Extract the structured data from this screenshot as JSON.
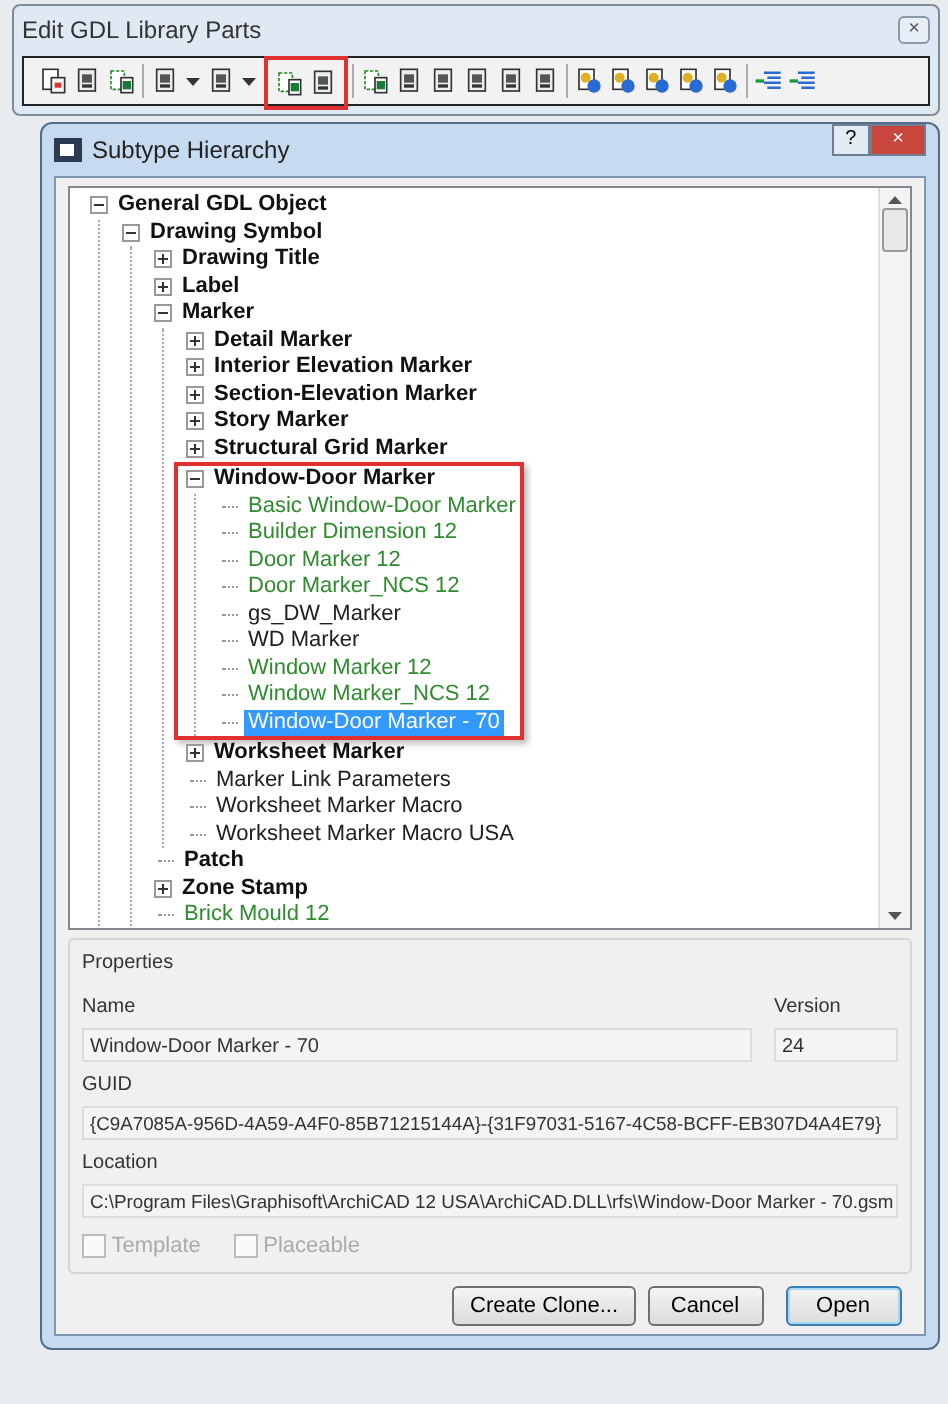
{
  "toolbar_window": {
    "title": "Edit GDL Library Parts",
    "close": "×",
    "groups": [
      {
        "buttons": [
          {
            "kind": "plain"
          },
          {
            "kind": "plain"
          },
          {
            "kind": "plain"
          }
        ]
      },
      {
        "buttons": [
          {
            "kind": "split"
          },
          {
            "kind": "split"
          }
        ],
        "highlighted_after": {
          "buttons": [
            {
              "kind": "plain"
            },
            {
              "kind": "plain"
            }
          ]
        }
      },
      {
        "buttons": [
          {
            "kind": "plain"
          },
          {
            "kind": "plain"
          },
          {
            "kind": "plain"
          },
          {
            "kind": "plain"
          },
          {
            "kind": "plain"
          },
          {
            "kind": "plain"
          }
        ]
      },
      {
        "buttons": [
          {
            "kind": "plain"
          },
          {
            "kind": "plain"
          },
          {
            "kind": "plain"
          },
          {
            "kind": "plain"
          },
          {
            "kind": "plain"
          }
        ]
      },
      {
        "buttons": [
          {
            "kind": "plain"
          },
          {
            "kind": "plain"
          }
        ]
      }
    ]
  },
  "dialog": {
    "title": "Subtype Hierarchy",
    "help": "?",
    "close": "×",
    "tree": [
      {
        "label": "General GDL Object",
        "kind": "category",
        "expanded": true,
        "children": [
          {
            "label": "Drawing Symbol",
            "kind": "category",
            "expanded": true,
            "children": [
              {
                "label": "Drawing Title",
                "kind": "category",
                "expanded": false
              },
              {
                "label": "Label",
                "kind": "category",
                "expanded": false
              },
              {
                "label": "Marker",
                "kind": "category",
                "expanded": true,
                "children": [
                  {
                    "label": "Detail Marker",
                    "kind": "category",
                    "expanded": false
                  },
                  {
                    "label": "Interior Elevation Marker",
                    "kind": "category",
                    "expanded": false
                  },
                  {
                    "label": "Section-Elevation Marker",
                    "kind": "category",
                    "expanded": false
                  },
                  {
                    "label": "Story Marker",
                    "kind": "category",
                    "expanded": false
                  },
                  {
                    "label": "Structural Grid Marker",
                    "kind": "category",
                    "expanded": false
                  },
                  {
                    "label": "Window-Door Marker",
                    "kind": "category",
                    "expanded": true,
                    "highlighted": true,
                    "children": [
                      {
                        "label": "Basic Window-Door Marker",
                        "kind": "part",
                        "color": "#2e8b2e",
                        "selected": false
                      },
                      {
                        "label": "Builder Dimension 12",
                        "kind": "part",
                        "color": "#2e8b2e",
                        "selected": false
                      },
                      {
                        "label": "Door Marker 12",
                        "kind": "part",
                        "color": "#2e8b2e",
                        "selected": false
                      },
                      {
                        "label": "Door Marker_NCS 12",
                        "kind": "part",
                        "color": "#2e8b2e",
                        "selected": false
                      },
                      {
                        "label": "gs_DW_Marker",
                        "kind": "part",
                        "color": "#202020",
                        "selected": false
                      },
                      {
                        "label": "WD Marker",
                        "kind": "part",
                        "color": "#202020",
                        "selected": false
                      },
                      {
                        "label": "Window Marker 12",
                        "kind": "part",
                        "color": "#2e8b2e",
                        "selected": false
                      },
                      {
                        "label": "Window Marker_NCS 12",
                        "kind": "part",
                        "color": "#2e8b2e",
                        "selected": false
                      },
                      {
                        "label": "Window-Door Marker - 70",
                        "kind": "part",
                        "selected": true
                      }
                    ]
                  },
                  {
                    "label": "Worksheet Marker",
                    "kind": "category",
                    "expanded": false
                  },
                  {
                    "label": "Marker Link Parameters",
                    "kind": "part",
                    "color": "#202020",
                    "selected": false
                  },
                  {
                    "label": "Worksheet Marker Macro",
                    "kind": "part",
                    "color": "#202020",
                    "selected": false
                  },
                  {
                    "label": "Worksheet Marker Macro USA",
                    "kind": "part",
                    "color": "#202020",
                    "selected": false
                  }
                ]
              },
              {
                "label": "Patch",
                "kind": "category"
              },
              {
                "label": "Zone Stamp",
                "kind": "category",
                "expanded": false
              },
              {
                "label": "Brick Mould 12",
                "kind": "part",
                "color": "#2e8b2e",
                "selected": false
              }
            ]
          }
        ]
      }
    ],
    "properties": {
      "title": "Properties",
      "name_label": "Name",
      "name": "Window-Door Marker - 70",
      "version_label": "Version",
      "version": "24",
      "guid_label": "GUID",
      "guid": "{C9A7085A-956D-4A59-A4F0-85B71215144A}-{31F97031-5167-4C58-BCFF-EB307D4A4E79}",
      "location_label": "Location",
      "location": "C:\\Program Files\\Graphisoft\\ArchiCAD 12 USA\\ArchiCAD.DLL\\rfs\\Window-Door Marker - 70.gsm",
      "checkboxes": [
        {
          "label": "Template",
          "checked": false,
          "disabled": true
        },
        {
          "label": "Placeable",
          "checked": false,
          "disabled": true
        }
      ]
    },
    "buttons": [
      {
        "label": "Create Clone...",
        "default": false
      },
      {
        "label": "Cancel",
        "default": false
      },
      {
        "label": "Open",
        "default": true
      }
    ]
  }
}
